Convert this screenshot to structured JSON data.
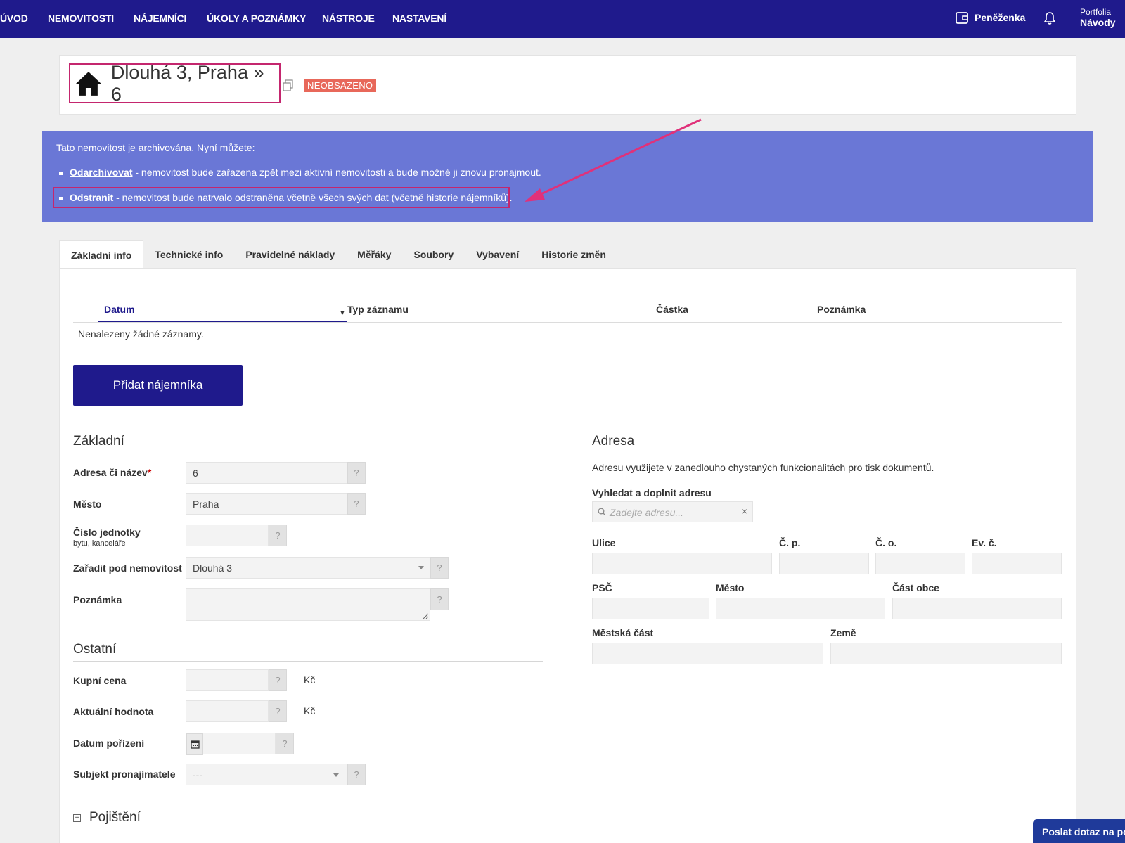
{
  "nav": {
    "items": [
      "ÚVOD",
      "NEMOVITOSTI",
      "NÁJEMNÍCI",
      "ÚKOLY A POZNÁMKY",
      "NÁSTROJE",
      "NASTAVENÍ"
    ],
    "wallet_label": "Peněženka",
    "portfolio_small": "Portfolia",
    "portfolio_big": "Návody"
  },
  "header": {
    "title": "Dlouhá 3, Praha » 6",
    "status": "NEOBSAZENO"
  },
  "banner": {
    "intro": "Tato nemovitost je archivována. Nyní můžete:",
    "item1_link": "Odarchivovat",
    "item1_text": " - nemovitost bude zařazena zpět mezi aktivní nemovitosti a bude možné ji znovu pronajmout.",
    "item2_link": "Odstranit",
    "item2_text": " - nemovitost bude natrvalo odstraněna včetně všech svých dat (včetně historie nájemníků)."
  },
  "tabs": [
    "Základní info",
    "Technické info",
    "Pravidelné náklady",
    "Měřáky",
    "Soubory",
    "Vybavení",
    "Historie změn"
  ],
  "table": {
    "columns": [
      "Datum",
      "Typ záznamu",
      "Částka",
      "Poznámka"
    ],
    "empty": "Nenalezeny žádné záznamy."
  },
  "add_tenant_button": "Přidat nájemníka",
  "basic": {
    "title": "Základní",
    "address_label": "Adresa či název",
    "address_value": "6",
    "city_label": "Město",
    "city_value": "Praha",
    "unit_label": "Číslo jednotky",
    "unit_sub": "bytu, kanceláře",
    "parent_label": "Zařadit pod nemovitost",
    "parent_value": "Dlouhá 3",
    "note_label": "Poznámka",
    "help": "?"
  },
  "other": {
    "title": "Ostatní",
    "price_label": "Kupní cena",
    "value_label": "Aktuální hodnota",
    "currency": "Kč",
    "date_label": "Datum pořízení",
    "subject_label": "Subjekt pronajímatele",
    "subject_value": "---"
  },
  "insurance": {
    "title": "Pojištění"
  },
  "address": {
    "title": "Adresa",
    "desc": "Adresu využijete v zanedlouho chystaných funkcionalitách pro tisk dokumentů.",
    "search_label": "Vyhledat a doplnit adresu",
    "search_placeholder": "Zadejte adresu...",
    "street": "Ulice",
    "cp": "Č. p.",
    "co": "Č. o.",
    "ev": "Ev. č.",
    "zip": "PSČ",
    "city": "Město",
    "district": "Část obce",
    "city_part": "Městská část",
    "country": "Země"
  },
  "corner_button": "Poslat dotaz na podporu",
  "colors": {
    "nav": "#1f1a8c",
    "banner": "#6a77d6",
    "badge": "#e8685a",
    "highlight": "#c4266e"
  }
}
